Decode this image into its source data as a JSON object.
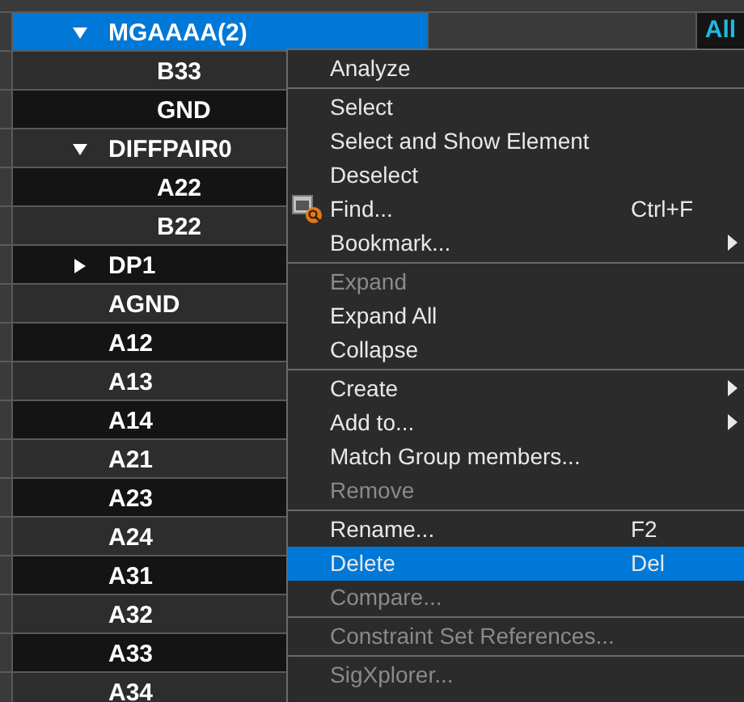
{
  "tree": [
    {
      "label": "MGAAAA(2)",
      "expanded": true,
      "selected": true,
      "column_3": "All",
      "children": [
        {
          "label": "B33",
          "selected": false
        },
        {
          "label": "GND",
          "selected": false
        }
      ]
    },
    {
      "label": "DIFFPAIR0",
      "expanded": true,
      "selected": false,
      "children": [
        {
          "label": "A22",
          "selected": false
        },
        {
          "label": "B22",
          "selected": false
        }
      ]
    },
    {
      "label": "DP1",
      "expanded": false,
      "selected": false
    },
    {
      "label": "AGND",
      "selected": false
    },
    {
      "label": "A12",
      "selected": false
    },
    {
      "label": "A13",
      "selected": false
    },
    {
      "label": "A14",
      "selected": false
    },
    {
      "label": "A21",
      "selected": false
    },
    {
      "label": "A23",
      "selected": false
    },
    {
      "label": "A24",
      "selected": false
    },
    {
      "label": "A31",
      "selected": false
    },
    {
      "label": "A32",
      "selected": false
    },
    {
      "label": "A33",
      "selected": false
    },
    {
      "label": "A34",
      "selected": false
    }
  ],
  "context_menu": {
    "groups": [
      [
        {
          "label": "Analyze",
          "kind": "plain",
          "disabled": false,
          "selected": false,
          "submenu": false
        }
      ],
      [
        {
          "label": "Select",
          "kind": "plain",
          "disabled": false,
          "selected": false,
          "submenu": false
        },
        {
          "label": "Select and Show Element",
          "kind": "plain",
          "disabled": false,
          "selected": false,
          "submenu": false
        },
        {
          "label": "Deselect",
          "kind": "plain",
          "disabled": false,
          "selected": false,
          "submenu": false
        },
        {
          "label": "Find...",
          "kind": "with_icon",
          "shortcut": "Ctrl+F",
          "disabled": false,
          "selected": false,
          "submenu": false
        },
        {
          "label": "Bookmark...",
          "kind": "plain",
          "disabled": false,
          "selected": false,
          "submenu": true
        }
      ],
      [
        {
          "label": "Expand",
          "kind": "plain",
          "disabled": true,
          "selected": false,
          "submenu": false
        },
        {
          "label": "Expand All",
          "kind": "plain",
          "disabled": false,
          "selected": false,
          "submenu": false
        },
        {
          "label": "Collapse",
          "kind": "plain",
          "disabled": false,
          "selected": false,
          "submenu": false
        }
      ],
      [
        {
          "label": "Create",
          "kind": "plain",
          "disabled": false,
          "selected": false,
          "submenu": true
        },
        {
          "label": "Add to...",
          "kind": "plain",
          "disabled": false,
          "selected": false,
          "submenu": true
        },
        {
          "label": "Match Group members...",
          "kind": "plain",
          "disabled": false,
          "selected": false,
          "submenu": false
        },
        {
          "label": "Remove",
          "kind": "plain",
          "disabled": true,
          "selected": false,
          "submenu": false
        }
      ],
      [
        {
          "label": "Rename...",
          "kind": "plain",
          "shortcut": "F2",
          "disabled": false,
          "selected": false,
          "submenu": false
        },
        {
          "label": "Delete",
          "kind": "plain",
          "shortcut": "Del",
          "disabled": false,
          "selected": true,
          "submenu": false
        },
        {
          "label": "Compare...",
          "kind": "plain",
          "disabled": true,
          "selected": false,
          "submenu": false
        }
      ],
      [
        {
          "label": "Constraint Set References...",
          "kind": "plain",
          "disabled": true,
          "selected": false,
          "submenu": false
        }
      ],
      [
        {
          "label": "SigXplorer...",
          "kind": "plain",
          "disabled": true,
          "selected": false,
          "submenu": false
        }
      ]
    ]
  }
}
